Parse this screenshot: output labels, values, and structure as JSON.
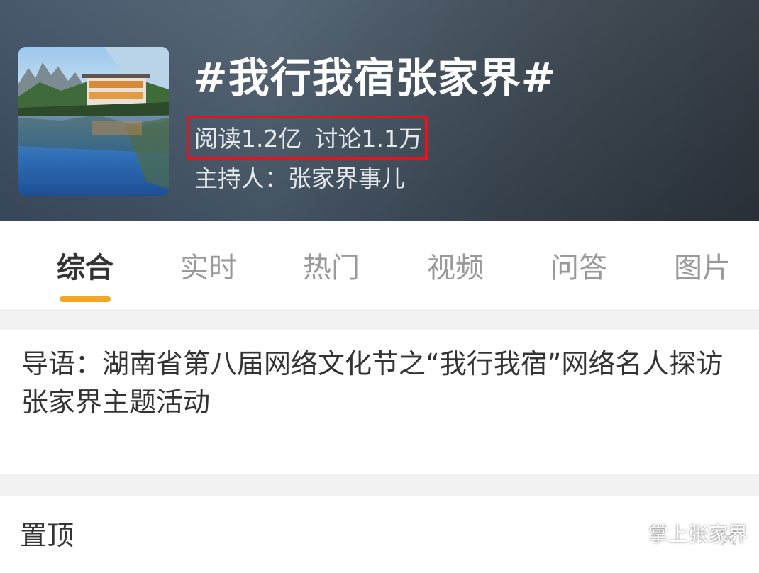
{
  "topic": {
    "title": "#我行我宿张家界#",
    "reads": "阅读1.2亿",
    "discussions": "讨论1.1万",
    "host": "主持人：张家界事儿"
  },
  "tabs": [
    "综合",
    "实时",
    "热门",
    "视频",
    "问答",
    "图片"
  ],
  "active_tab": "综合",
  "intro": "导语：湖南省第八届网络文化节之“我行我宿”网络名人探访张家界主题活动",
  "pinned": {
    "label": "置顶"
  },
  "watermark": {
    "text": "掌上张家界",
    "icon": "wechat-icon"
  },
  "colors": {
    "highlight_box": "#e8121c",
    "tab_indicator": "#f5a623",
    "header_bg": "#3e5064"
  }
}
